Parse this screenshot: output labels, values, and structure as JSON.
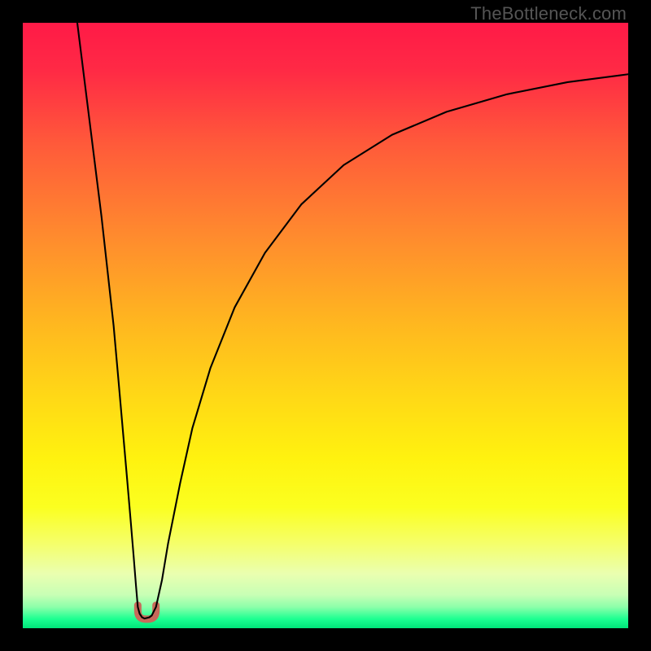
{
  "watermark": "TheBottleneck.com",
  "chart_data": {
    "type": "line",
    "title": "",
    "xlabel": "",
    "ylabel": "",
    "xlim": [
      0,
      100
    ],
    "ylim": [
      0,
      100
    ],
    "grid": false,
    "legend": null,
    "background": {
      "type": "vertical-gradient",
      "stops": [
        {
          "offset": 0.0,
          "color": "#ff1a47"
        },
        {
          "offset": 0.08,
          "color": "#ff2a45"
        },
        {
          "offset": 0.2,
          "color": "#ff5a3a"
        },
        {
          "offset": 0.35,
          "color": "#ff8a2e"
        },
        {
          "offset": 0.5,
          "color": "#ffb81f"
        },
        {
          "offset": 0.62,
          "color": "#ffd916"
        },
        {
          "offset": 0.72,
          "color": "#fff20f"
        },
        {
          "offset": 0.8,
          "color": "#fbff20"
        },
        {
          "offset": 0.86,
          "color": "#f5ff6a"
        },
        {
          "offset": 0.91,
          "color": "#eaffb0"
        },
        {
          "offset": 0.945,
          "color": "#c8ffb5"
        },
        {
          "offset": 0.965,
          "color": "#8cffaa"
        },
        {
          "offset": 0.985,
          "color": "#1bff91"
        },
        {
          "offset": 1.0,
          "color": "#00e57a"
        }
      ]
    },
    "series": [
      {
        "name": "left-branch",
        "x": [
          9.0,
          10.0,
          11.0,
          12.0,
          13.0,
          14.0,
          15.0,
          15.8,
          16.5,
          17.2,
          17.8,
          18.3,
          18.7,
          19.0
        ],
        "y": [
          100.0,
          92.0,
          84.0,
          76.0,
          68.0,
          59.0,
          50.0,
          41.0,
          33.0,
          25.0,
          18.0,
          12.0,
          7.0,
          3.5
        ]
      },
      {
        "name": "minimum-lobe",
        "x": [
          19.0,
          19.3,
          19.7,
          20.1,
          20.5,
          20.9,
          21.3,
          21.6,
          22.0
        ],
        "y": [
          3.5,
          2.4,
          1.8,
          1.6,
          1.7,
          1.8,
          2.1,
          2.7,
          3.5
        ]
      },
      {
        "name": "right-branch",
        "x": [
          22.0,
          23.0,
          24.0,
          26.0,
          28.0,
          31.0,
          35.0,
          40.0,
          46.0,
          53.0,
          61.0,
          70.0,
          80.0,
          90.0,
          100.0
        ],
        "y": [
          3.5,
          8.0,
          14.0,
          24.0,
          33.0,
          43.0,
          53.0,
          62.0,
          70.0,
          76.5,
          81.5,
          85.3,
          88.2,
          90.2,
          91.5
        ]
      }
    ],
    "annotations": {
      "minimum_marker": {
        "x_range": [
          19.0,
          22.0
        ],
        "y_range": [
          1.5,
          3.8
        ],
        "color": "#c76a5a",
        "shape": "u"
      }
    }
  }
}
